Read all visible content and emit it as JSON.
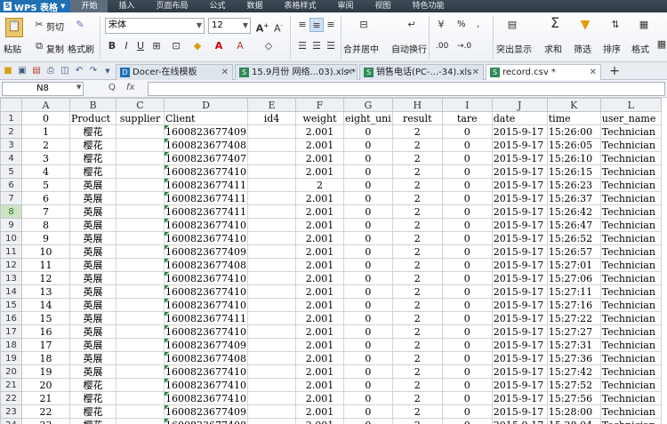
{
  "app": {
    "name": "WPS 表格",
    "logo_letter": "S"
  },
  "menu": [
    "开始",
    "插入",
    "页面布局",
    "公式",
    "数据",
    "表格样式",
    "审阅",
    "视图",
    "特色功能"
  ],
  "ribbon": {
    "paste": "粘贴",
    "cut": "剪切",
    "copy": "复制",
    "format_painter": "格式刷",
    "font_name": "宋体",
    "font_size": "12",
    "merge_center": "合并居中",
    "wrap_text": "自动换行",
    "percent": "%",
    "comma": ",",
    "dec_inc": ".00",
    "dec_dec": "→.0",
    "conditional": "突出显示",
    "sum": "求和",
    "filter": "筛选",
    "sort": "排序",
    "format": "格式"
  },
  "tabs": [
    {
      "label": "Docer-在线模板",
      "active": false
    },
    {
      "label": "15.9月份 网络...03).xls *",
      "active": false
    },
    {
      "label": "销售电话(PC-...-34).xls",
      "active": false
    },
    {
      "label": "record.csv *",
      "active": true
    }
  ],
  "formula_bar": {
    "cell_ref": "N8",
    "fx": "fx",
    "zoom": "Q",
    "value": ""
  },
  "columns": [
    "A",
    "B",
    "C",
    "D",
    "E",
    "F",
    "G",
    "H",
    "I",
    "J",
    "K",
    "L"
  ],
  "selected_row": 8,
  "rows": [
    [
      "1",
      "0",
      "Product",
      "supplier",
      "Client",
      "id4",
      "weight",
      "eight_uni",
      "result",
      "tare",
      "date",
      "time",
      "user_name"
    ],
    [
      "2",
      "1",
      "樱花",
      "",
      "1600823677409",
      "",
      "2.001",
      "0",
      "2",
      "0",
      "2015-9-17",
      "15:26:00",
      "Technician"
    ],
    [
      "3",
      "2",
      "樱花",
      "",
      "1600823677408",
      "",
      "2.001",
      "0",
      "2",
      "0",
      "2015-9-17",
      "15:26:05",
      "Technician"
    ],
    [
      "4",
      "3",
      "樱花",
      "",
      "1600823677407",
      "",
      "2.001",
      "0",
      "2",
      "0",
      "2015-9-17",
      "15:26:10",
      "Technician"
    ],
    [
      "5",
      "4",
      "樱花",
      "",
      "1600823677410",
      "",
      "2.001",
      "0",
      "2",
      "0",
      "2015-9-17",
      "15:26:15",
      "Technician"
    ],
    [
      "6",
      "5",
      "英展",
      "",
      "1600823677411",
      "",
      "2",
      "0",
      "2",
      "0",
      "2015-9-17",
      "15:26:23",
      "Technician"
    ],
    [
      "7",
      "6",
      "英展",
      "",
      "1600823677411",
      "",
      "2.001",
      "0",
      "2",
      "0",
      "2015-9-17",
      "15:26:37",
      "Technician"
    ],
    [
      "8",
      "7",
      "英展",
      "",
      "1600823677411",
      "",
      "2.001",
      "0",
      "2",
      "0",
      "2015-9-17",
      "15:26:42",
      "Technician"
    ],
    [
      "9",
      "8",
      "英展",
      "",
      "1600823677410",
      "",
      "2.001",
      "0",
      "2",
      "0",
      "2015-9-17",
      "15:26:47",
      "Technician"
    ],
    [
      "10",
      "9",
      "英展",
      "",
      "1600823677410",
      "",
      "2.001",
      "0",
      "2",
      "0",
      "2015-9-17",
      "15:26:52",
      "Technician"
    ],
    [
      "11",
      "10",
      "英展",
      "",
      "1600823677409",
      "",
      "2.001",
      "0",
      "2",
      "0",
      "2015-9-17",
      "15:26:57",
      "Technician"
    ],
    [
      "12",
      "11",
      "英展",
      "",
      "1600823677408",
      "",
      "2.001",
      "0",
      "2",
      "0",
      "2015-9-17",
      "15:27:01",
      "Technician"
    ],
    [
      "13",
      "12",
      "英展",
      "",
      "1600823677410",
      "",
      "2.001",
      "0",
      "2",
      "0",
      "2015-9-17",
      "15:27:06",
      "Technician"
    ],
    [
      "14",
      "13",
      "英展",
      "",
      "1600823677410",
      "",
      "2.001",
      "0",
      "2",
      "0",
      "2015-9-17",
      "15:27:11",
      "Technician"
    ],
    [
      "15",
      "14",
      "英展",
      "",
      "1600823677410",
      "",
      "2.001",
      "0",
      "2",
      "0",
      "2015-9-17",
      "15:27:16",
      "Technician"
    ],
    [
      "16",
      "15",
      "英展",
      "",
      "1600823677411",
      "",
      "2.001",
      "0",
      "2",
      "0",
      "2015-9-17",
      "15:27:22",
      "Technician"
    ],
    [
      "17",
      "16",
      "英展",
      "",
      "1600823677410",
      "",
      "2.001",
      "0",
      "2",
      "0",
      "2015-9-17",
      "15:27:27",
      "Technician"
    ],
    [
      "18",
      "17",
      "英展",
      "",
      "1600823677409",
      "",
      "2.001",
      "0",
      "2",
      "0",
      "2015-9-17",
      "15:27:31",
      "Technician"
    ],
    [
      "19",
      "18",
      "英展",
      "",
      "1600823677408",
      "",
      "2.001",
      "0",
      "2",
      "0",
      "2015-9-17",
      "15:27:36",
      "Technician"
    ],
    [
      "20",
      "19",
      "英展",
      "",
      "1600823677410",
      "",
      "2.001",
      "0",
      "2",
      "0",
      "2015-9-17",
      "15:27:42",
      "Technician"
    ],
    [
      "21",
      "20",
      "樱花",
      "",
      "1600823677410",
      "",
      "2.001",
      "0",
      "2",
      "0",
      "2015-9-17",
      "15:27:52",
      "Technician"
    ],
    [
      "22",
      "21",
      "樱花",
      "",
      "1600823677410",
      "",
      "2.001",
      "0",
      "2",
      "0",
      "2015-9-17",
      "15:27:56",
      "Technician"
    ],
    [
      "23",
      "22",
      "樱花",
      "",
      "1600823677409",
      "",
      "2.001",
      "0",
      "2",
      "0",
      "2015-9-17",
      "15:28:00",
      "Technician"
    ],
    [
      "24",
      "23",
      "樱花",
      "",
      "1600823677408",
      "",
      "2.001",
      "0",
      "2",
      "0",
      "2015-9-17",
      "15:28:04",
      "Technician"
    ]
  ]
}
